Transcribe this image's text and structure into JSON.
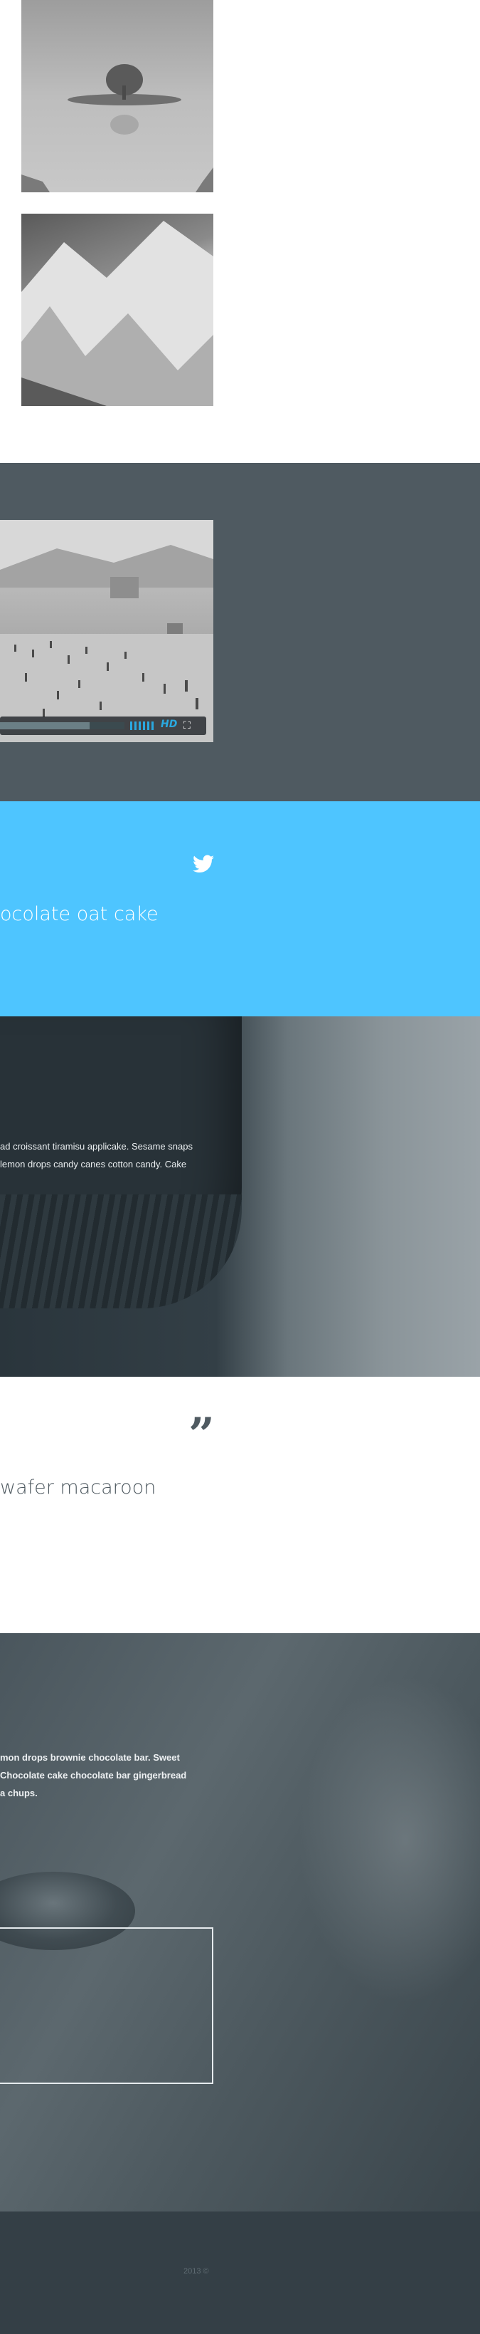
{
  "gallery": {
    "images": [
      {
        "name": "lake-island-photo"
      },
      {
        "name": "snowy-mountain-photo"
      }
    ]
  },
  "video": {
    "progress_fraction": 0.72,
    "hd_label": "HD",
    "fullscreen_icon": "fullscreen-icon",
    "volume_icon": "volume-bars-icon"
  },
  "tweet": {
    "icon": "twitter-bird-icon",
    "text": "ocolate oat cake",
    "accent": "#4ec5ff"
  },
  "sweater": {
    "text": "ad croissant tiramisu applicake. Sesame snaps lemon drops candy canes cotton candy. Cake"
  },
  "quote": {
    "icon": "quote-mark-icon",
    "mark": "”",
    "text": "wafer macaroon"
  },
  "coffee": {
    "text": "mon drops brownie chocolate bar. Sweet Chocolate cake chocolate bar gingerbread a chups."
  },
  "footer": {
    "text": "2013 ©"
  }
}
